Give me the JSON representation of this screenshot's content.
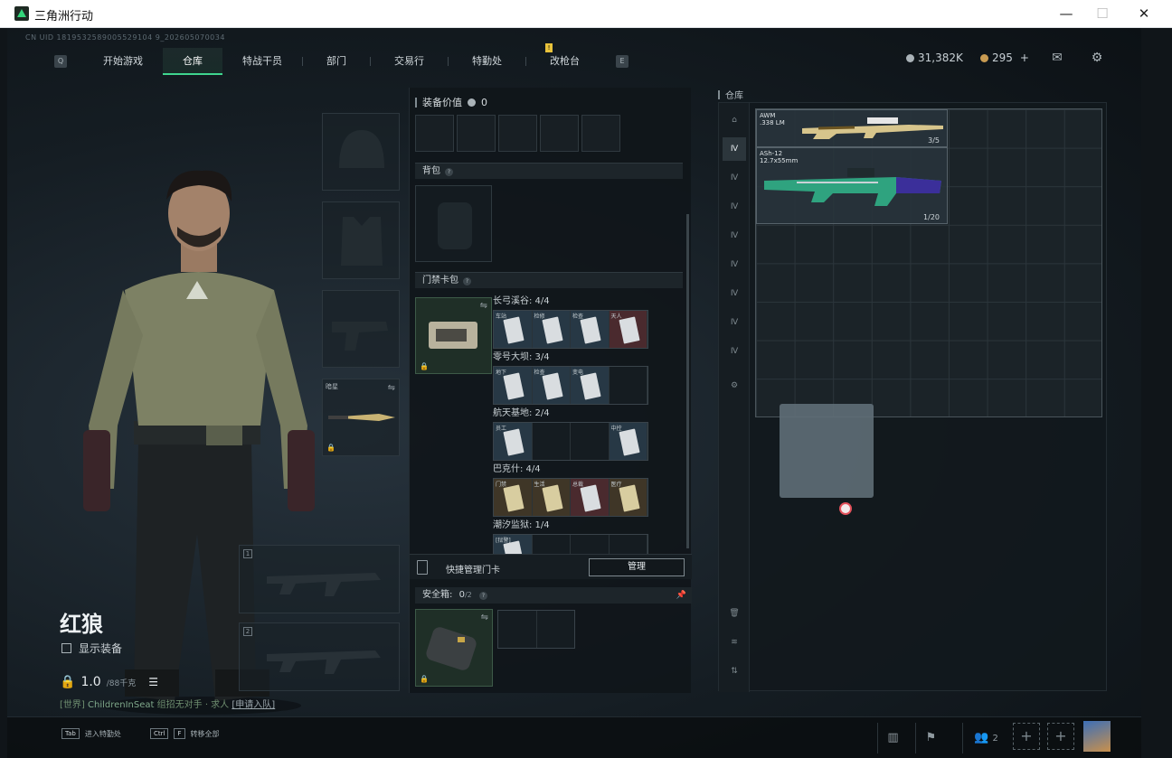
{
  "window": {
    "title": "三角洲行动",
    "controls": {
      "minimize": "—",
      "maximize": "☐",
      "close": "✕"
    }
  },
  "uid": "CN UID 1819532589005529104 9_202605070034",
  "nav": {
    "left_key": "Q",
    "right_key": "E",
    "tabs": [
      "开始游戏",
      "仓库",
      "特战干员",
      "部门",
      "交易行",
      "特勤处",
      "改枪台"
    ],
    "active": "仓库",
    "alert": "!"
  },
  "currency": {
    "silver": "31,382K",
    "gold": "295",
    "gold_plus": "+"
  },
  "character": {
    "name": "红狼",
    "show_gear_label": "显示装备",
    "weight": "1.0",
    "weight_unit": "/88千克"
  },
  "chat": {
    "channel": "[世界]",
    "sender": "ChildrenInSeat",
    "message": "组招无对手 · 求人",
    "link": "[申请入队]"
  },
  "gear_slots": {
    "melee_label": "暗星"
  },
  "weapon_slots": [
    "1",
    "2"
  ],
  "mid": {
    "equip_value_label": "装备价值",
    "equip_value": "0",
    "backpack_label": "背包",
    "cardbag_label": "门禁卡包",
    "help": "?",
    "maps": [
      {
        "title": "长弓溪谷: 4/4",
        "cards": [
          {
            "name": "车站",
            "color": "blue"
          },
          {
            "name": "检修",
            "color": "blue"
          },
          {
            "name": "检查",
            "color": "blue"
          },
          {
            "name": "天人",
            "color": "red"
          }
        ]
      },
      {
        "title": "零号大坝: 3/4",
        "cards": [
          {
            "name": "地下",
            "color": "blue"
          },
          {
            "name": "检查",
            "color": "blue"
          },
          {
            "name": "变电",
            "color": "blue"
          },
          {
            "name": "",
            "color": "empty"
          }
        ]
      },
      {
        "title": "航天基地: 2/4",
        "cards": [
          {
            "name": "员工",
            "color": "blue"
          },
          {
            "name": "",
            "color": "empty"
          },
          {
            "name": "",
            "color": "empty"
          },
          {
            "name": "中控",
            "color": "blue"
          }
        ]
      },
      {
        "title": "巴克什: 4/4",
        "cards": [
          {
            "name": "门禁",
            "color": "gold"
          },
          {
            "name": "生活",
            "color": "gold"
          },
          {
            "name": "总裁",
            "color": "red"
          },
          {
            "name": "医疗",
            "color": "gold"
          }
        ]
      },
      {
        "title": "潮汐监狱: 1/4",
        "cards": [
          {
            "name": "[狱警]",
            "color": "blue"
          },
          {
            "name": "",
            "color": "empty"
          },
          {
            "name": "",
            "color": "empty"
          },
          {
            "name": "",
            "color": "empty"
          }
        ]
      }
    ],
    "quick_manage_label": "快捷管理门卡",
    "manage_button": "管理",
    "safebox_label": "安全箱:",
    "safebox_count": "0",
    "safebox_total": "/2"
  },
  "warehouse": {
    "label": "仓库",
    "items": [
      {
        "name": "AWM",
        "ammo": ".338 LM",
        "count": "3/5"
      },
      {
        "name": "ASh-12",
        "ammo": "12.7x55mm",
        "count": "1/20"
      }
    ]
  },
  "bottom": {
    "hint1_key": "Tab",
    "hint1_label": "进入特勤处",
    "hint2_key1": "Ctrl",
    "hint2_key2": "F",
    "hint2_label": "转移全部",
    "squad_count": "2",
    "plus": "+"
  }
}
